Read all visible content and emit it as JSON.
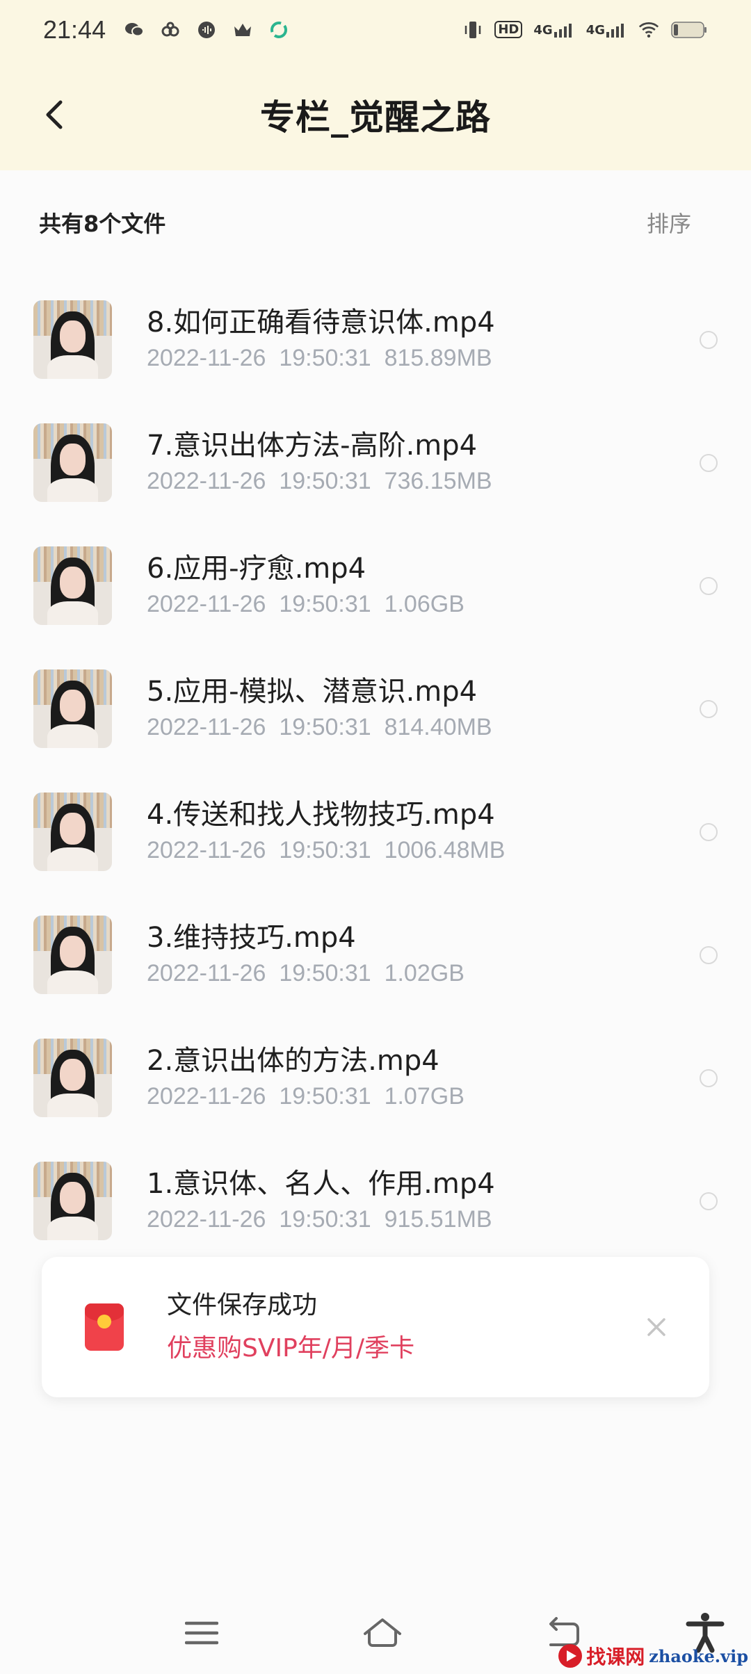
{
  "status_bar": {
    "time": "21:44",
    "left_icons": [
      "wechat-icon",
      "link-icon",
      "sound-icon",
      "crown-icon",
      "sync-icon"
    ],
    "hd_label": "HD",
    "network_1": "4G",
    "network_2": "4G"
  },
  "header": {
    "title": "专栏_觉醒之路"
  },
  "summary": {
    "count_label": "共有8个文件",
    "sort_label": "排序"
  },
  "files": [
    {
      "name": "8.如何正确看待意识体.mp4",
      "date": "2022-11-26",
      "time": "19:50:31",
      "size": "815.89MB"
    },
    {
      "name": "7.意识出体方法-高阶.mp4",
      "date": "2022-11-26",
      "time": "19:50:31",
      "size": "736.15MB"
    },
    {
      "name": "6.应用-疗愈.mp4",
      "date": "2022-11-26",
      "time": "19:50:31",
      "size": "1.06GB"
    },
    {
      "name": "5.应用-模拟、潜意识.mp4",
      "date": "2022-11-26",
      "time": "19:50:31",
      "size": "814.40MB"
    },
    {
      "name": "4.传送和找人找物技巧.mp4",
      "date": "2022-11-26",
      "time": "19:50:31",
      "size": "1006.48MB"
    },
    {
      "name": "3.维持技巧.mp4",
      "date": "2022-11-26",
      "time": "19:50:31",
      "size": "1.02GB"
    },
    {
      "name": "2.意识出体的方法.mp4",
      "date": "2022-11-26",
      "time": "19:50:31",
      "size": "1.07GB"
    },
    {
      "name": "1.意识体、名人、作用.mp4",
      "date": "2022-11-26",
      "time": "19:50:31",
      "size": "915.51MB"
    }
  ],
  "toast": {
    "title": "文件保存成功",
    "promo": "优惠购SVIP年/月/季卡"
  },
  "watermark": {
    "cn": "找课网",
    "en": "zhaoke.vip"
  },
  "colors": {
    "header_bg": "#fbf7e3",
    "promo": "#e0405e",
    "meta_gray": "#a6abb3"
  }
}
